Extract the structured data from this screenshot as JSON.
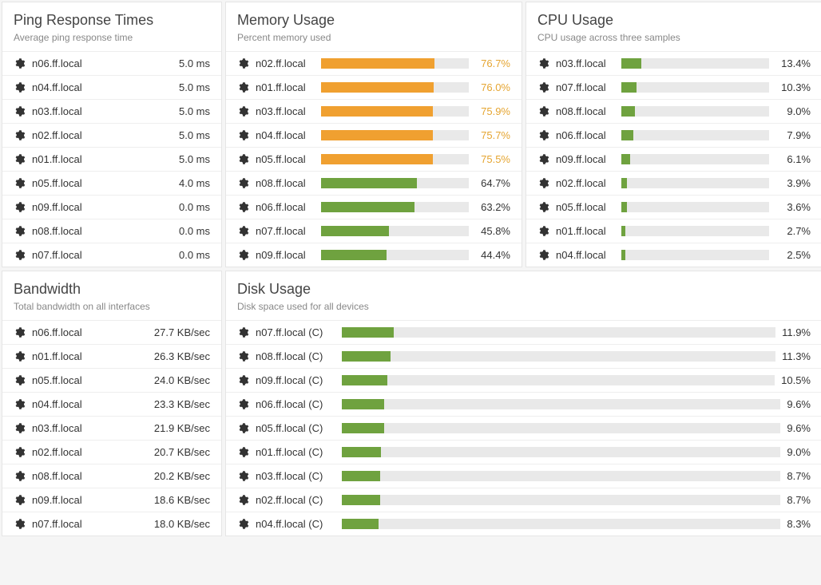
{
  "panels": {
    "ping": {
      "title": "Ping Response Times",
      "subtitle": "Average ping response time",
      "rows": [
        {
          "host": "n06.ff.local",
          "value": "5.0 ms"
        },
        {
          "host": "n04.ff.local",
          "value": "5.0 ms"
        },
        {
          "host": "n03.ff.local",
          "value": "5.0 ms"
        },
        {
          "host": "n02.ff.local",
          "value": "5.0 ms"
        },
        {
          "host": "n01.ff.local",
          "value": "5.0 ms"
        },
        {
          "host": "n05.ff.local",
          "value": "4.0 ms"
        },
        {
          "host": "n09.ff.local",
          "value": "0.0 ms"
        },
        {
          "host": "n08.ff.local",
          "value": "0.0 ms"
        },
        {
          "host": "n07.ff.local",
          "value": "0.0 ms"
        }
      ]
    },
    "memory": {
      "title": "Memory Usage",
      "subtitle": "Percent memory used",
      "rows": [
        {
          "host": "n02.ff.local",
          "pct": 76.7,
          "label": "76.7%",
          "color": "orange"
        },
        {
          "host": "n01.ff.local",
          "pct": 76.0,
          "label": "76.0%",
          "color": "orange"
        },
        {
          "host": "n03.ff.local",
          "pct": 75.9,
          "label": "75.9%",
          "color": "orange"
        },
        {
          "host": "n04.ff.local",
          "pct": 75.7,
          "label": "75.7%",
          "color": "orange"
        },
        {
          "host": "n05.ff.local",
          "pct": 75.5,
          "label": "75.5%",
          "color": "orange"
        },
        {
          "host": "n08.ff.local",
          "pct": 64.7,
          "label": "64.7%",
          "color": "green"
        },
        {
          "host": "n06.ff.local",
          "pct": 63.2,
          "label": "63.2%",
          "color": "green"
        },
        {
          "host": "n07.ff.local",
          "pct": 45.8,
          "label": "45.8%",
          "color": "green"
        },
        {
          "host": "n09.ff.local",
          "pct": 44.4,
          "label": "44.4%",
          "color": "green"
        }
      ]
    },
    "cpu": {
      "title": "CPU Usage",
      "subtitle": "CPU usage across three samples",
      "rows": [
        {
          "host": "n03.ff.local",
          "pct": 13.4,
          "label": "13.4%",
          "color": "green"
        },
        {
          "host": "n07.ff.local",
          "pct": 10.3,
          "label": "10.3%",
          "color": "green"
        },
        {
          "host": "n08.ff.local",
          "pct": 9.0,
          "label": "9.0%",
          "color": "green"
        },
        {
          "host": "n06.ff.local",
          "pct": 7.9,
          "label": "7.9%",
          "color": "green"
        },
        {
          "host": "n09.ff.local",
          "pct": 6.1,
          "label": "6.1%",
          "color": "green"
        },
        {
          "host": "n02.ff.local",
          "pct": 3.9,
          "label": "3.9%",
          "color": "green"
        },
        {
          "host": "n05.ff.local",
          "pct": 3.6,
          "label": "3.6%",
          "color": "green"
        },
        {
          "host": "n01.ff.local",
          "pct": 2.7,
          "label": "2.7%",
          "color": "green"
        },
        {
          "host": "n04.ff.local",
          "pct": 2.5,
          "label": "2.5%",
          "color": "green"
        }
      ]
    },
    "bandwidth": {
      "title": "Bandwidth",
      "subtitle": "Total bandwidth on all interfaces",
      "rows": [
        {
          "host": "n06.ff.local",
          "value": "27.7 KB/sec"
        },
        {
          "host": "n01.ff.local",
          "value": "26.3 KB/sec"
        },
        {
          "host": "n05.ff.local",
          "value": "24.0 KB/sec"
        },
        {
          "host": "n04.ff.local",
          "value": "23.3 KB/sec"
        },
        {
          "host": "n03.ff.local",
          "value": "21.9 KB/sec"
        },
        {
          "host": "n02.ff.local",
          "value": "20.7 KB/sec"
        },
        {
          "host": "n08.ff.local",
          "value": "20.2 KB/sec"
        },
        {
          "host": "n09.ff.local",
          "value": "18.6 KB/sec"
        },
        {
          "host": "n07.ff.local",
          "value": "18.0 KB/sec"
        }
      ]
    },
    "disk": {
      "title": "Disk Usage",
      "subtitle": "Disk space used for all devices",
      "rows": [
        {
          "host": "n07.ff.local (C)",
          "pct": 11.9,
          "label": "11.9%",
          "color": "green"
        },
        {
          "host": "n08.ff.local (C)",
          "pct": 11.3,
          "label": "11.3%",
          "color": "green"
        },
        {
          "host": "n09.ff.local (C)",
          "pct": 10.5,
          "label": "10.5%",
          "color": "green"
        },
        {
          "host": "n06.ff.local (C)",
          "pct": 9.6,
          "label": "9.6%",
          "color": "green"
        },
        {
          "host": "n05.ff.local (C)",
          "pct": 9.6,
          "label": "9.6%",
          "color": "green"
        },
        {
          "host": "n01.ff.local (C)",
          "pct": 9.0,
          "label": "9.0%",
          "color": "green"
        },
        {
          "host": "n03.ff.local (C)",
          "pct": 8.7,
          "label": "8.7%",
          "color": "green"
        },
        {
          "host": "n02.ff.local (C)",
          "pct": 8.7,
          "label": "8.7%",
          "color": "green"
        },
        {
          "host": "n04.ff.local (C)",
          "pct": 8.3,
          "label": "8.3%",
          "color": "green"
        }
      ]
    }
  },
  "chart_data": [
    {
      "type": "bar",
      "title": "Memory Usage",
      "ylabel": "Percent memory used",
      "categories": [
        "n02.ff.local",
        "n01.ff.local",
        "n03.ff.local",
        "n04.ff.local",
        "n05.ff.local",
        "n08.ff.local",
        "n06.ff.local",
        "n07.ff.local",
        "n09.ff.local"
      ],
      "values": [
        76.7,
        76.0,
        75.9,
        75.7,
        75.5,
        64.7,
        63.2,
        45.8,
        44.4
      ],
      "ylim": [
        0,
        100
      ]
    },
    {
      "type": "bar",
      "title": "CPU Usage",
      "ylabel": "CPU usage across three samples",
      "categories": [
        "n03.ff.local",
        "n07.ff.local",
        "n08.ff.local",
        "n06.ff.local",
        "n09.ff.local",
        "n02.ff.local",
        "n05.ff.local",
        "n01.ff.local",
        "n04.ff.local"
      ],
      "values": [
        13.4,
        10.3,
        9.0,
        7.9,
        6.1,
        3.9,
        3.6,
        2.7,
        2.5
      ],
      "ylim": [
        0,
        100
      ]
    },
    {
      "type": "bar",
      "title": "Disk Usage",
      "ylabel": "Disk space used for all devices",
      "categories": [
        "n07.ff.local (C)",
        "n08.ff.local (C)",
        "n09.ff.local (C)",
        "n06.ff.local (C)",
        "n05.ff.local (C)",
        "n01.ff.local (C)",
        "n03.ff.local (C)",
        "n02.ff.local (C)",
        "n04.ff.local (C)"
      ],
      "values": [
        11.9,
        11.3,
        10.5,
        9.6,
        9.6,
        9.0,
        8.7,
        8.7,
        8.3
      ],
      "ylim": [
        0,
        100
      ]
    }
  ]
}
